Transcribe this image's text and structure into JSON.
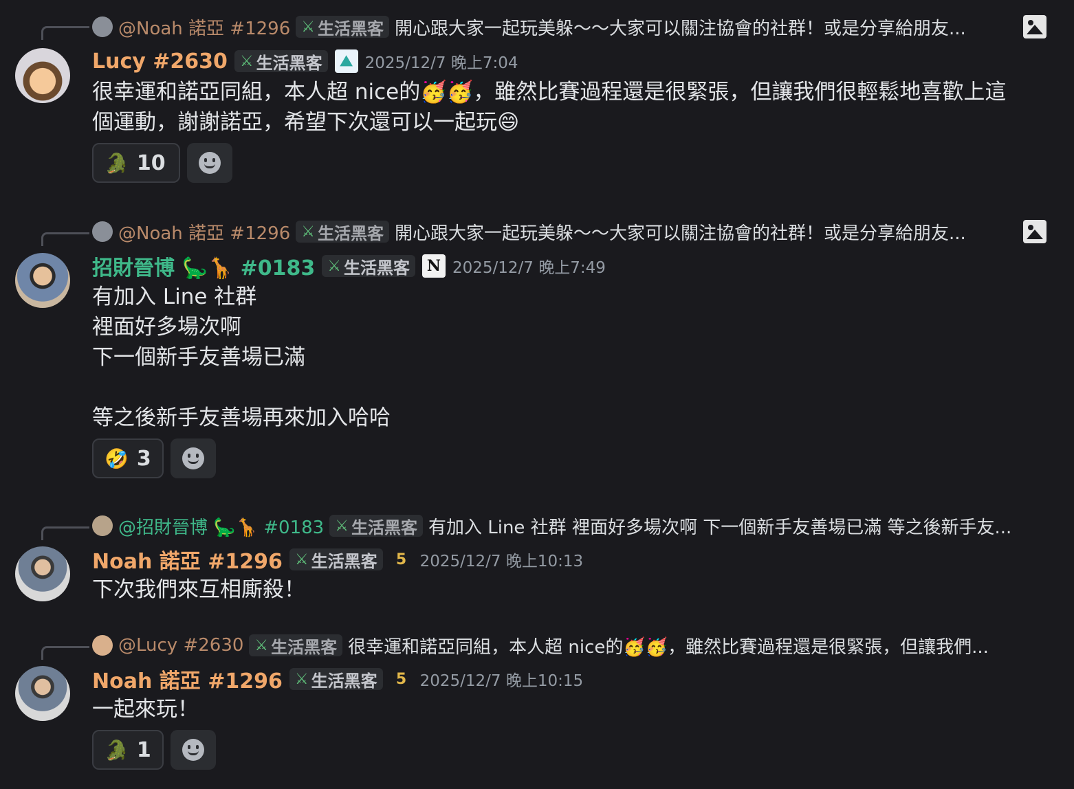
{
  "messages": [
    {
      "reply": {
        "name": "@Noah 諾亞 #1296",
        "tag": "生活黑客",
        "text": "開心跟大家一起玩美躲～～大家可以關注協會的社群！或是分享給朋友..."
      },
      "author": "Lucy #2630",
      "tag": "生活黑客",
      "timestamp": "2025/12/7 晚上7:04",
      "body": "很幸運和諾亞同組，本人超 nice的🥳🥳，雖然比賽過程還是很緊張，但讓我們很輕鬆地喜歡上這\n個運動，謝謝諾亞，希望下次還可以一起玩😄",
      "reaction": {
        "emoji": "🐊",
        "count": "10"
      }
    },
    {
      "reply": {
        "name": "@Noah 諾亞 #1296",
        "tag": "生活黑客",
        "text": "開心跟大家一起玩美躲～～大家可以關注協會的社群！或是分享給朋友..."
      },
      "author": "招財晉博 🦕🦒 #0183",
      "tag": "生活黑客",
      "timestamp": "2025/12/7 晚上7:49",
      "body": "有加入 Line 社群\n裡面好多場次啊\n下一個新手友善場已滿\n\n等之後新手友善場再來加入哈哈",
      "reaction": {
        "emoji": "🤣",
        "count": "3"
      }
    },
    {
      "reply": {
        "name": "@招財晉博 🦕🦒 #0183",
        "tag": "生活黑客",
        "text": "有加入 Line 社群 裡面好多場次啊 下一個新手友善場已滿  等之後新手友..."
      },
      "author": "Noah 諾亞 #1296",
      "tag": "生活黑客",
      "timestamp": "2025/12/7 晚上10:13",
      "body": "下次我們來互相廝殺！"
    },
    {
      "reply": {
        "name": "@Lucy #2630",
        "tag": "生活黑客",
        "text": "很幸運和諾亞同組，本人超 nice的🥳🥳，雖然比賽過程還是很緊張，但讓我們..."
      },
      "author": "Noah 諾亞 #1296",
      "tag": "生活黑客",
      "timestamp": "2025/12/7 晚上10:15",
      "body": "一起來玩！",
      "reaction": {
        "emoji": "🐊",
        "count": "1"
      }
    }
  ],
  "icons": {
    "image_attachment": "image-icon",
    "tag_icon": "sword-icon",
    "add_reaction": "smiley-icon"
  },
  "colors": {
    "background": "#1a1a1e",
    "name_orange": "#f0a76a",
    "name_green": "#3fb98a"
  }
}
